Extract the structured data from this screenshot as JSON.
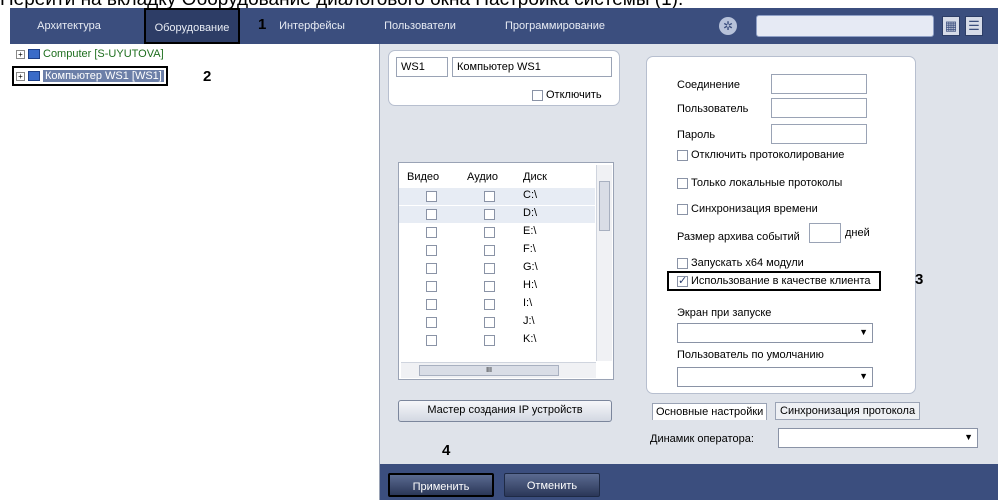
{
  "caption": "Перейти на вкладку Оборудование диалогового окна Настройка системы (1).",
  "toolbar": {
    "tabs": [
      "Архитектура",
      "Оборудование",
      "Интерфейсы",
      "Пользователи",
      "Программирование"
    ],
    "search": {
      "value": "",
      "placeholder": ""
    }
  },
  "markers": {
    "m1": "1",
    "m2": "2",
    "m3": "3",
    "m4": "4"
  },
  "tree": {
    "items": [
      {
        "label": "Computer [S-UYUTOVA]",
        "expander": "+"
      },
      {
        "label": "Компьютер WS1 [WS1]",
        "expander": "+"
      }
    ]
  },
  "computer": {
    "id": "WS1",
    "name": "Компьютер WS1",
    "disable_label": "Отключить"
  },
  "grid": {
    "headers": [
      "Видео",
      "Аудио",
      "Диск"
    ],
    "rows": [
      {
        "drive": "C:\\"
      },
      {
        "drive": "D:\\"
      },
      {
        "drive": "E:\\"
      },
      {
        "drive": "F:\\"
      },
      {
        "drive": "G:\\"
      },
      {
        "drive": "H:\\"
      },
      {
        "drive": "I:\\"
      },
      {
        "drive": "J:\\"
      },
      {
        "drive": "K:\\"
      }
    ],
    "scroll_mid": "III"
  },
  "wizard_button": "Мастер создания IP устройств",
  "settings": {
    "connection_label": "Соединение",
    "user_label": "Пользователь",
    "password_label": "Пароль",
    "disable_logging": "Отключить протоколирование",
    "local_logs_only": "Только локальные протоколы",
    "time_sync": "Синхронизация времени",
    "archive_size_label": "Размер архива событий",
    "archive_unit": "дней",
    "run_x64": "Запускать x64 модули",
    "use_as_client": "Использование в качестве клиента",
    "startup_screen_label": "Экран при запуске",
    "default_user_label": "Пользователь по умолчанию"
  },
  "settings_tabs": [
    "Основные настройки",
    "Синхронизация протокола"
  ],
  "operator_speaker_label": "Динамик оператора:",
  "actions": {
    "apply": "Применить",
    "cancel": "Отменить"
  }
}
